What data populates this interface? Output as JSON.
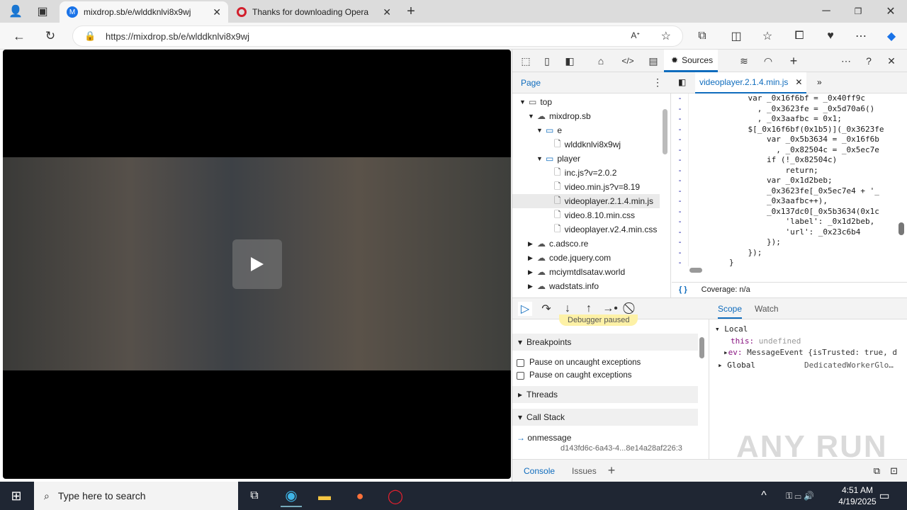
{
  "browser": {
    "tabs": [
      {
        "title": "mixdrop.sb/e/wlddknlvi8x9wj",
        "icon": "mixdrop-icon",
        "active": true
      },
      {
        "title": "Thanks for downloading Opera",
        "icon": "opera-icon",
        "active": false
      }
    ],
    "url": "https://mixdrop.sb/e/wlddknlvi8x9wj"
  },
  "devtools": {
    "active_tool": "Sources",
    "nav_tab": "Page",
    "file_tab": "videoplayer.2.1.4.min.js",
    "tree": [
      {
        "label": "top",
        "level": 0,
        "type": "frame",
        "arrow": "open"
      },
      {
        "label": "mixdrop.sb",
        "level": 1,
        "type": "cloud",
        "arrow": "open"
      },
      {
        "label": "e",
        "level": 2,
        "type": "folder",
        "arrow": "open"
      },
      {
        "label": "wlddknlvi8x9wj",
        "level": 3,
        "type": "file",
        "arrow": ""
      },
      {
        "label": "player",
        "level": 2,
        "type": "folder",
        "arrow": "open"
      },
      {
        "label": "inc.js?v=2.0.2",
        "level": 3,
        "type": "file",
        "arrow": ""
      },
      {
        "label": "video.min.js?v=8.19",
        "level": 3,
        "type": "file",
        "arrow": ""
      },
      {
        "label": "videoplayer.2.1.4.min.js",
        "level": 3,
        "type": "file",
        "arrow": "",
        "selected": true
      },
      {
        "label": "video.8.10.min.css",
        "level": 3,
        "type": "file",
        "arrow": ""
      },
      {
        "label": "videoplayer.v2.4.min.css",
        "level": 3,
        "type": "file",
        "arrow": ""
      },
      {
        "label": "c.adsco.re",
        "level": 1,
        "type": "cloud",
        "arrow": "closed"
      },
      {
        "label": "code.jquery.com",
        "level": 1,
        "type": "cloud",
        "arrow": "closed"
      },
      {
        "label": "mciymtdlsatav.world",
        "level": 1,
        "type": "cloud",
        "arrow": "closed"
      },
      {
        "label": "wadstats.info",
        "level": 1,
        "type": "cloud",
        "arrow": "closed"
      }
    ],
    "code_lines": [
      "            var _0x16f6bf = _0x40ff9c",
      "              , _0x3623fe = _0x5d70a6()",
      "              , _0x3aafbc = 0x1;",
      "            $[_0x16f6bf(0x1b5)](_0x3623fe",
      "                var _0x5b3634 = _0x16f6b",
      "                  , _0x82504c = _0x5ec7e",
      "                if (!_0x82504c)",
      "                    return;",
      "                var _0x1d2beb;",
      "                _0x3623fe[_0x5ec7e4 + '_",
      "                _0x3aafbc++),",
      "                _0x137dc0[_0x5b3634(0x1c",
      "                    'label': _0x1d2beb,",
      "                    'url': _0x23c6b4",
      "                });",
      "            });",
      "        }"
    ],
    "gutter": "-",
    "coverage": "Coverage: n/a",
    "pretty_print": "{ }",
    "paused_banner": "Debugger paused",
    "sections": {
      "breakpoints": "Breakpoints",
      "threads": "Threads",
      "call_stack": "Call Stack"
    },
    "checkboxes": [
      "Pause on uncaught exceptions",
      "Pause on caught exceptions"
    ],
    "call_stack": {
      "fn": "onmessage",
      "loc": "d143fd6c-6a43-4...8e14a28af226:3"
    },
    "scope_tabs": [
      "Scope",
      "Watch"
    ],
    "scope": {
      "local": "Local",
      "this_key": "this:",
      "this_val": "undefined",
      "ev_key": "ev:",
      "ev_val": "MessageEvent {isTrusted: true, d",
      "global": "Global",
      "global_val": "DedicatedWorkerGlo…"
    },
    "drawer_tabs": [
      "Console",
      "Issues"
    ]
  },
  "taskbar": {
    "search_placeholder": "Type here to search",
    "time": "4:51 AM",
    "date": "4/19/2025"
  },
  "watermark": "ANY RUN"
}
